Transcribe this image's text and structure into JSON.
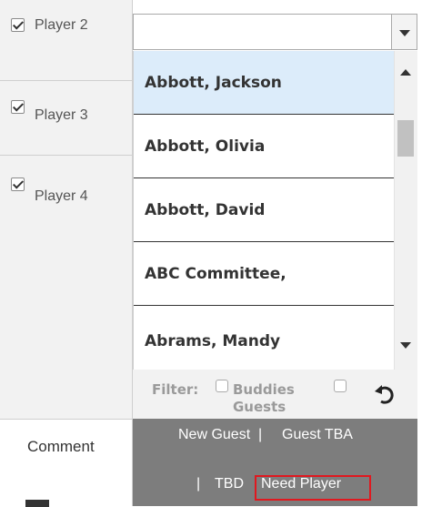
{
  "players": [
    {
      "label": "Player 2",
      "checked": true
    },
    {
      "label": "Player 3",
      "checked": true
    },
    {
      "label": "Player 4",
      "checked": true
    }
  ],
  "dropdown": {
    "value": "",
    "options": [
      {
        "label": "Abbott, Jackson",
        "selected": true
      },
      {
        "label": "Abbott, Olivia"
      },
      {
        "label": "Abbott, David"
      },
      {
        "label": "ABC Committee,"
      },
      {
        "label": "Abrams, Mandy"
      }
    ]
  },
  "filter": {
    "label": "Filter:",
    "buddies": "Buddies",
    "guests": "Guests",
    "reset_icon": "undo-icon"
  },
  "comment_tab": {
    "label": "Comment"
  },
  "guest_actions": {
    "new_guest": "New Guest",
    "guest_tba": "Guest TBA",
    "tbd": "TBD",
    "need_player": "Need Player",
    "sep": "|"
  },
  "colors": {
    "selected_bg": "#dcecfa",
    "guest_bar": "#7d7d7d",
    "highlight": "#e0181f"
  }
}
